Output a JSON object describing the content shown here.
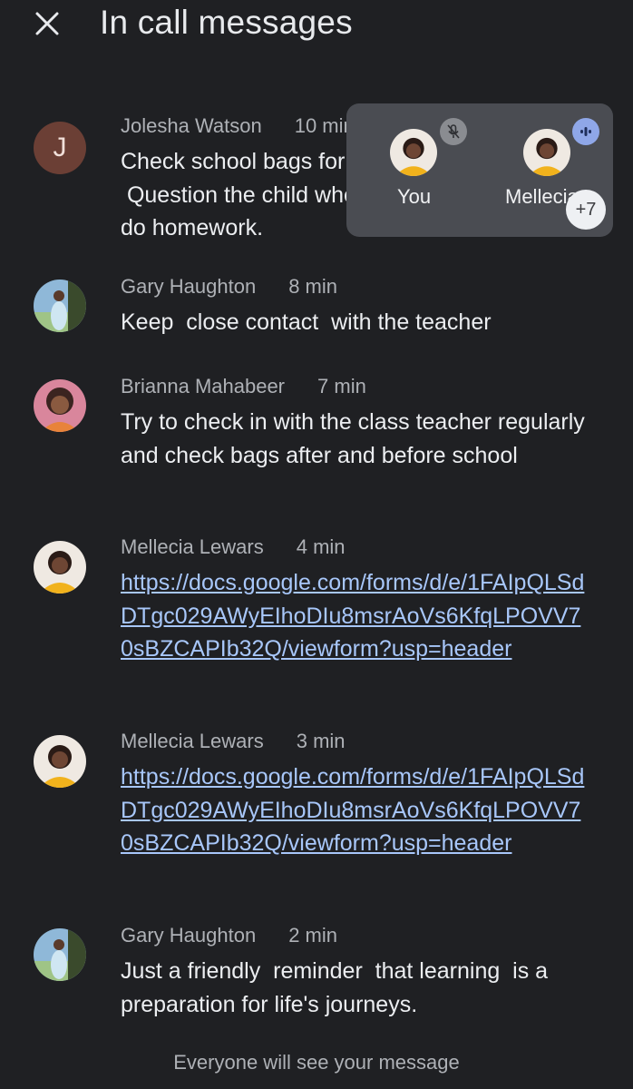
{
  "header": {
    "title": "In call messages",
    "close_icon": "close-icon"
  },
  "messages": [
    {
      "sender": "Jolesha Watson",
      "time": "10 min",
      "avatar_initial": "J",
      "text": "Check school bags for\n Question the child when\ndo homework."
    },
    {
      "sender": "Gary Haughton",
      "time": "8 min",
      "text": "Keep  close contact  with the teacher"
    },
    {
      "sender": "Brianna Mahabeer",
      "time": "7 min",
      "text": "Try to check in with the class teacher regularly and check bags after and before school"
    },
    {
      "sender": "Mellecia Lewars",
      "time": "4 min",
      "text": "https://docs.google.com/forms/d/e/1FAIpQLSdDTgc029AWyEIhoDIu8msrAoVs6KfqLPOVV70sBZCAPIb32Q/viewform?usp=header"
    },
    {
      "sender": "Mellecia Lewars",
      "time": "3 min",
      "text": "https://docs.google.com/forms/d/e/1FAIpQLSdDTgc029AWyEIhoDIu8msrAoVs6KfqLPOVV70sBZCAPIb32Q/viewform?usp=header"
    },
    {
      "sender": "Gary Haughton",
      "time": "2 min",
      "text": "Just a friendly  reminder  that learning  is a preparation for life's journeys."
    }
  ],
  "participants_panel": {
    "you_label": "You",
    "other_label": "Mellecia",
    "more_count": "+7"
  },
  "footer": {
    "hint": "Everyone will see your message"
  },
  "colors": {
    "background": "#1f2023",
    "link": "#a8c7fa",
    "panel": "#4a4c52",
    "speaking": "#8fa7e8"
  }
}
